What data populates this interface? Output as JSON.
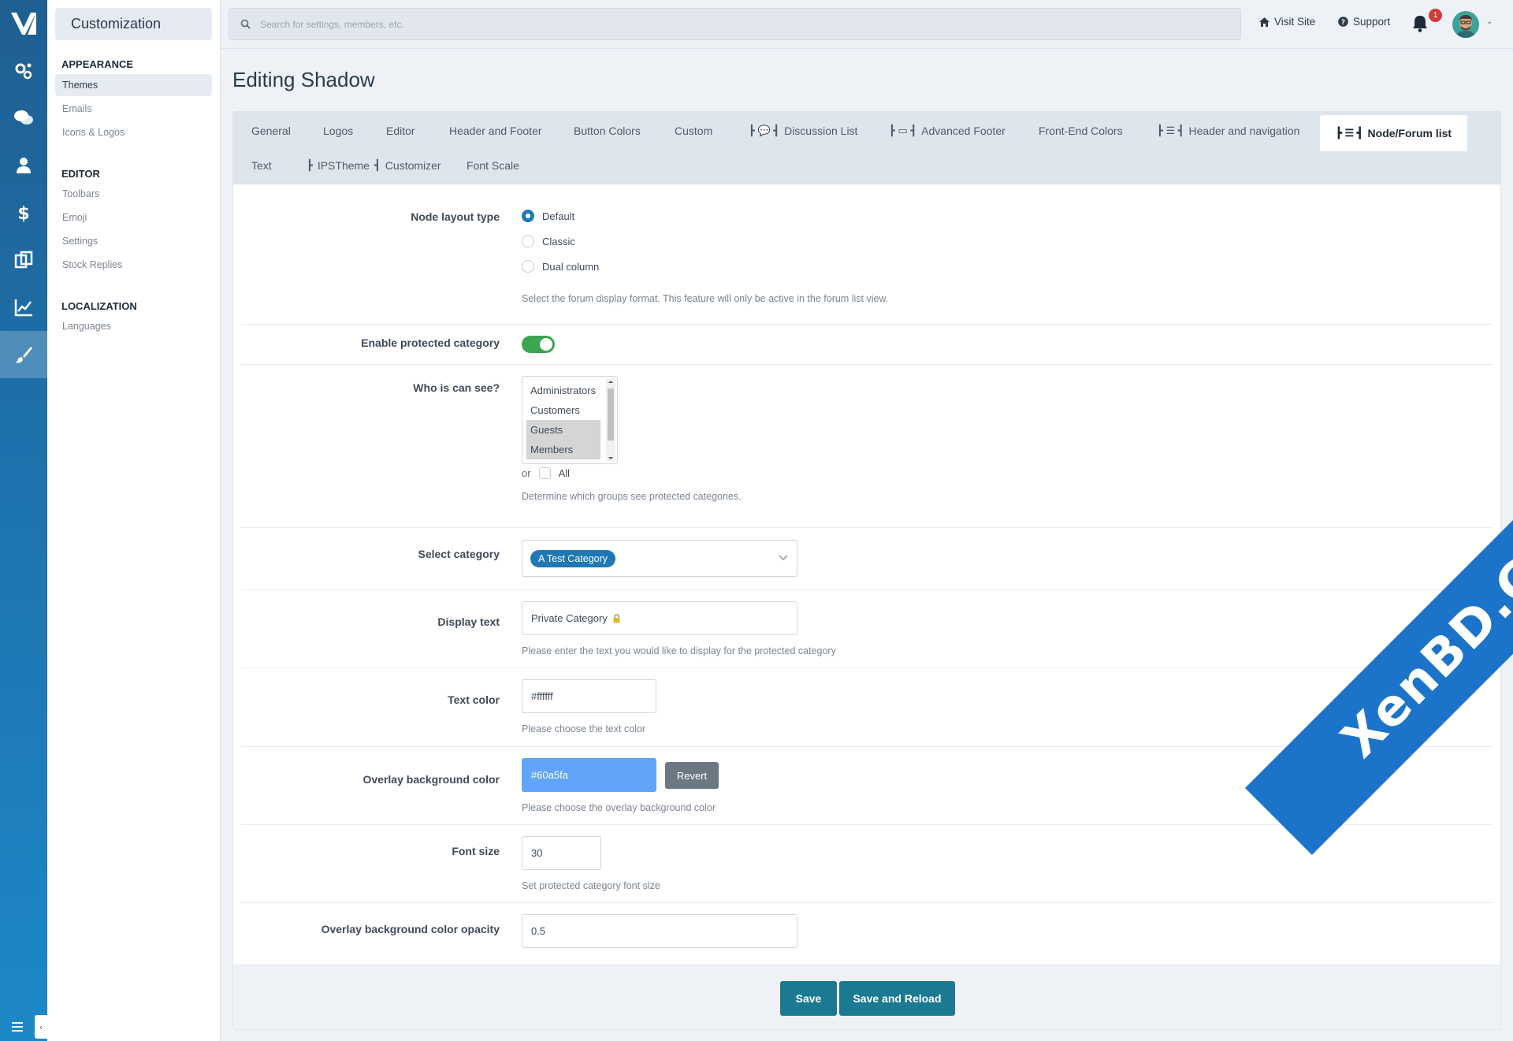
{
  "sidebar": {
    "title": "Customization",
    "groups": [
      {
        "heading": "APPEARANCE",
        "items": [
          "Themes",
          "Emails",
          "Icons & Logos"
        ]
      },
      {
        "heading": "EDITOR",
        "items": [
          "Toolbars",
          "Emoji",
          "Settings",
          "Stock Replies"
        ]
      },
      {
        "heading": "LOCALIZATION",
        "items": [
          "Languages"
        ]
      }
    ],
    "active_item": "Themes",
    "collapse_glyph": "‹"
  },
  "rail": {
    "icons": [
      "logo-icon",
      "gears-icon",
      "chat-icon",
      "user-icon",
      "dollar-icon",
      "copy-icon",
      "chart-icon",
      "brush-icon"
    ],
    "active_icon": "brush-icon"
  },
  "topbar": {
    "search_placeholder": "Search for settings, members, etc.",
    "visit_site": "Visit Site",
    "support": "Support",
    "notification_count": "1"
  },
  "page": {
    "title": "Editing Shadow"
  },
  "tabs": {
    "row1": [
      "General",
      "Logos",
      "Editor",
      "Header and Footer",
      "Button Colors",
      "Custom",
      "┣ 💬 ┫ Discussion List",
      "┣ ▭ ┫ Advanced Footer",
      "Front-End Colors",
      "┣ ☰ ┫ Header and navigation",
      "┣ ☰ ┫ Node/Forum list"
    ],
    "row2": [
      "Text",
      "┣ IPSTheme ┫ Customizer",
      "Font Scale"
    ],
    "active": "Node/Forum list",
    "row1_labels": {
      "general": "General",
      "logos": "Logos",
      "editor": "Editor",
      "header_footer": "Header and Footer",
      "button_colors": "Button Colors",
      "custom": "Custom",
      "discussion_list": "Discussion List",
      "advanced_footer": "Advanced Footer",
      "frontend_colors": "Front-End Colors",
      "header_nav": "Header and navigation",
      "node_forum": "Node/Forum list"
    },
    "row2_labels": {
      "text": "Text",
      "ipstheme": "IPSTheme",
      "customizer": "Customizer",
      "font_scale": "Font Scale"
    }
  },
  "form": {
    "node_layout": {
      "label": "Node layout type",
      "options": [
        "Default",
        "Classic",
        "Dual column"
      ],
      "selected": "Default",
      "hint": "Select the forum display format. This feature will only be active in the forum list view."
    },
    "protected": {
      "label": "Enable protected category",
      "enabled": true
    },
    "who_can_see": {
      "label": "Who is can see?",
      "options": [
        "Administrators",
        "Customers",
        "Guests",
        "Members"
      ],
      "selected": [
        "Guests",
        "Members"
      ],
      "or_text": "or",
      "all_label": "All",
      "hint": "Determine which groups see protected categories."
    },
    "select_category": {
      "label": "Select category",
      "chip": "A Test Category"
    },
    "display_text": {
      "label": "Display text",
      "value": "Private Category",
      "value_icon": "lock-icon",
      "hint": "Please enter the text you would like to display for the protected category"
    },
    "text_color": {
      "label": "Text color",
      "value": "#ffffff",
      "hint": "Please choose the text color"
    },
    "overlay_bg": {
      "label": "Overlay background color",
      "value": "#60a5fa",
      "revert": "Revert",
      "hint": "Please choose the overlay background color"
    },
    "font_size": {
      "label": "Font size",
      "value": "30",
      "hint": "Set protected category font size"
    },
    "opacity": {
      "label": "Overlay background color opacity",
      "value": "0.5"
    }
  },
  "actions": {
    "save": "Save",
    "save_reload": "Save and Reload"
  },
  "watermark": "XenBD.Com",
  "colors": {
    "accent": "#1f78b4",
    "toggle_on": "#3ba551",
    "primary_button": "#1b7a92",
    "overlay_swatch": "#60a5fa"
  }
}
